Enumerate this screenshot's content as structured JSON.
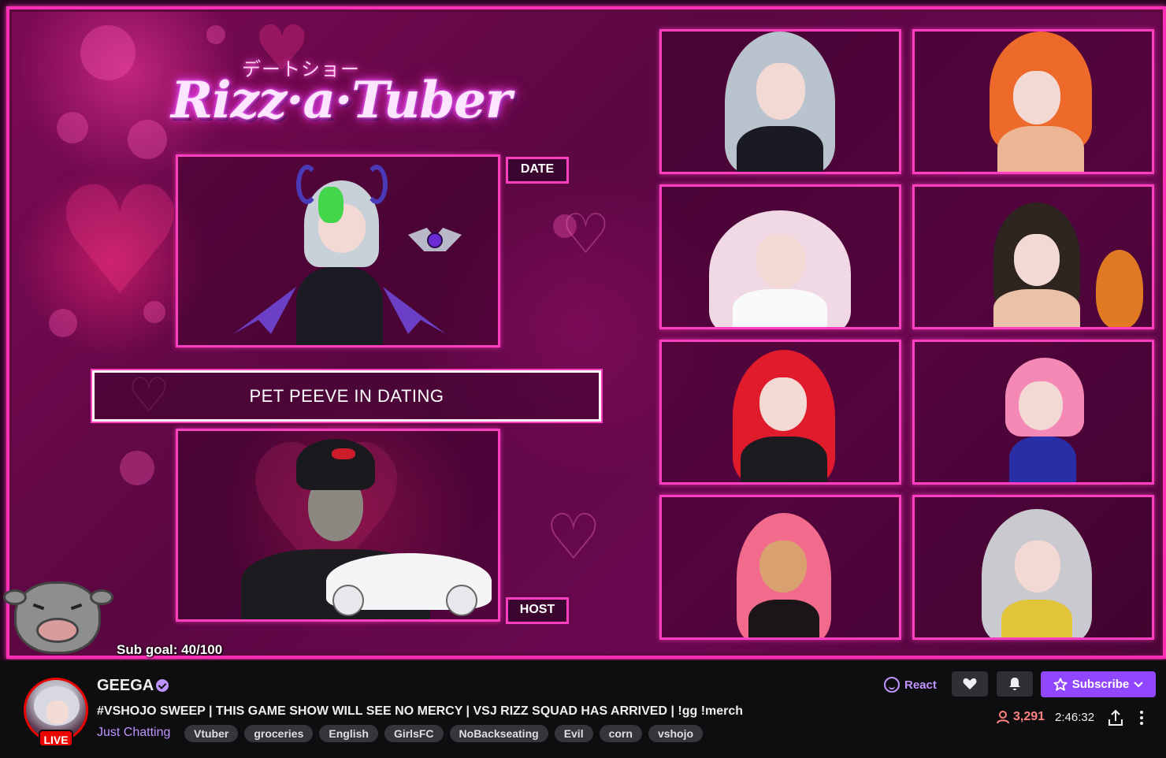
{
  "overlay": {
    "logo_japanese": "デートショー",
    "logo_text": "Rizz·a·Tuber",
    "date_label": "DATE",
    "host_label": "HOST",
    "question": "PET PEEVE IN DATING",
    "sub_goal": "Sub goal: 40/100"
  },
  "channel": {
    "name": "GEEGA",
    "live_badge": "LIVE",
    "title": "#VSHOJO SWEEP | THIS GAME SHOW WILL SEE NO MERCY | VSJ RIZZ SQUAD HAS ARRIVED | !gg !merch",
    "category": "Just Chatting",
    "tags": [
      "Vtuber",
      "groceries",
      "English",
      "GirlsFC",
      "NoBackseating",
      "Evil",
      "corn",
      "vshojo"
    ],
    "viewers": "3,291",
    "uptime": "2:46:32"
  },
  "actions": {
    "react_label": "React",
    "subscribe_label": "Subscribe"
  },
  "colors": {
    "neon_pink": "#ff3fbf",
    "twitch_purple": "#9147ff",
    "live_red": "#eb0400",
    "viewer_red": "#ff8280"
  }
}
